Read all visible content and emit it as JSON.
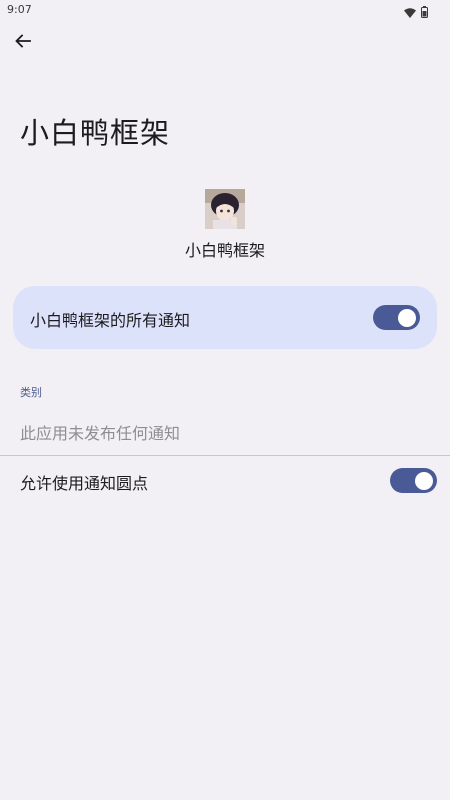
{
  "status_bar": {
    "time": "9:07",
    "icons": [
      "wifi-icon",
      "battery-icon"
    ]
  },
  "header": {
    "back_icon": "arrow-left-icon",
    "title": "小白鸭框架"
  },
  "app": {
    "name": "小白鸭框架",
    "icon": "app-avatar-icon"
  },
  "all_notifications": {
    "label": "小白鸭框架的所有通知",
    "enabled": true
  },
  "category": {
    "label": "类别",
    "empty_text": "此应用未发布任何通知"
  },
  "notification_dot": {
    "label": "允许使用通知圆点",
    "enabled": true
  },
  "colors": {
    "background": "#f2eff5",
    "card": "#dde2fb",
    "toggle_on": "#4a5a96",
    "section_label": "#4d5b8f"
  }
}
